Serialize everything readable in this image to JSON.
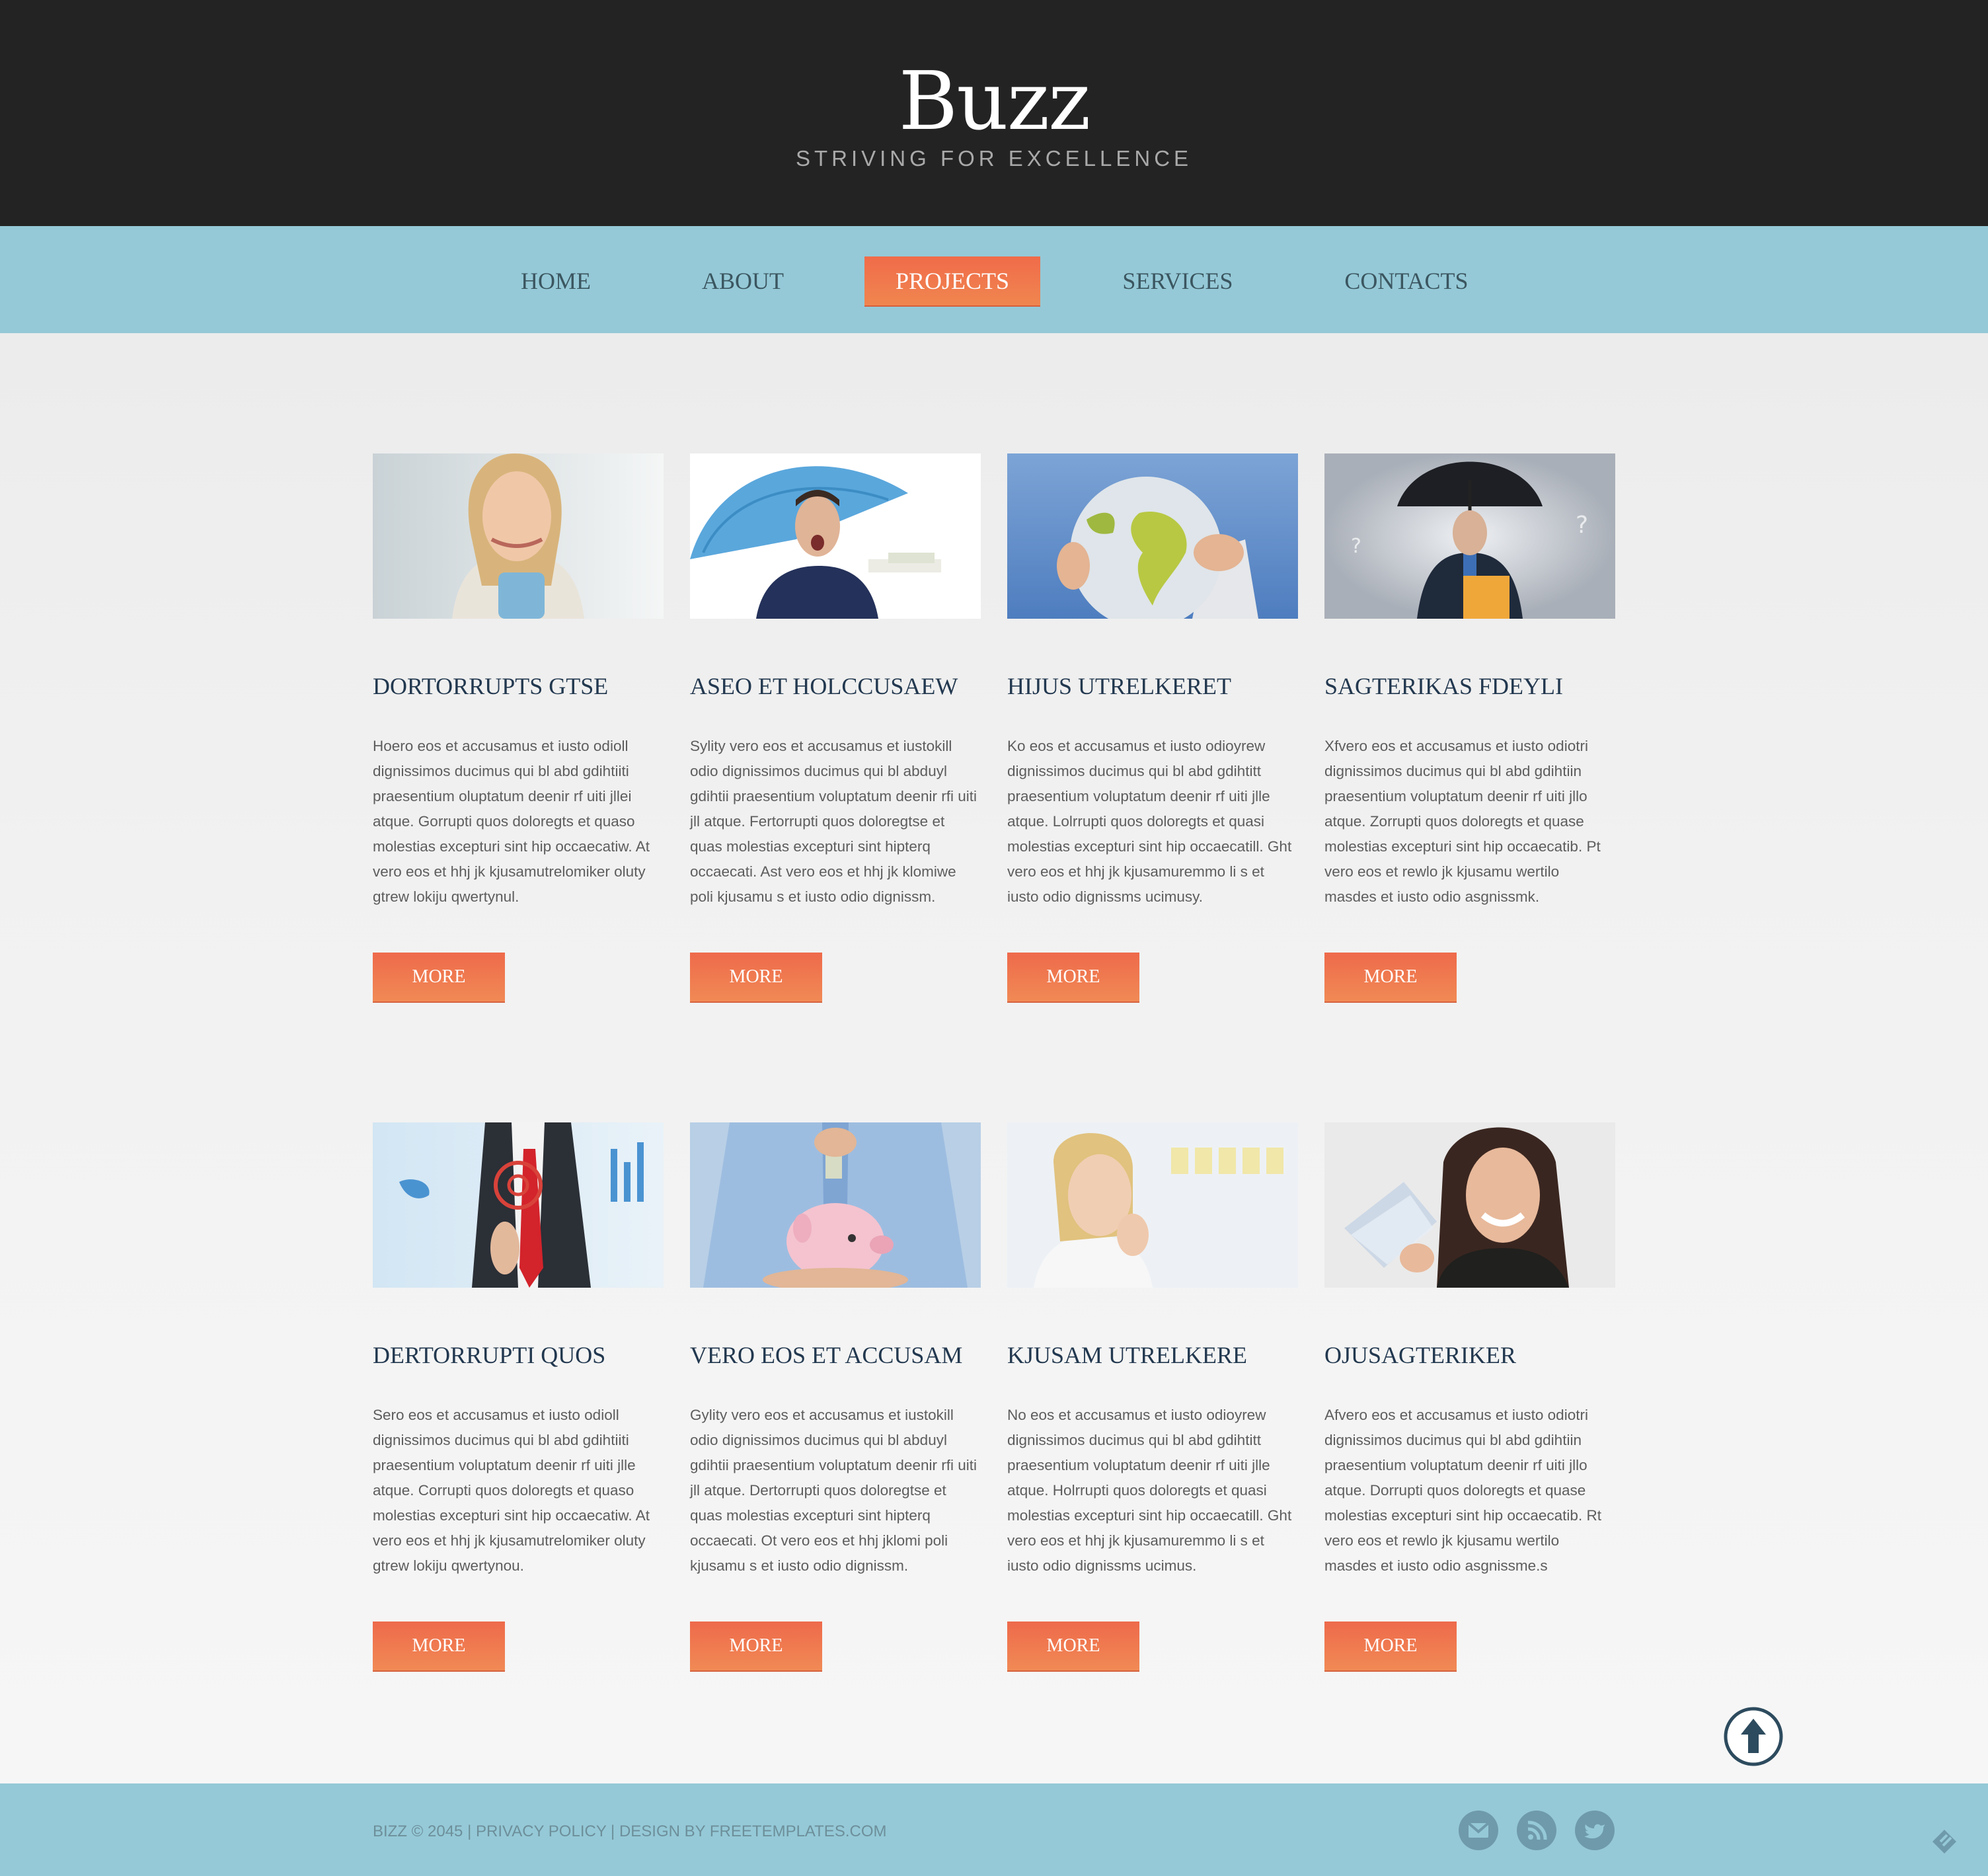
{
  "header": {
    "logo": "Buzz",
    "tagline": "STRIVING FOR EXCELLENCE"
  },
  "nav": {
    "items": [
      {
        "label": "HOME"
      },
      {
        "label": "ABOUT"
      },
      {
        "label": "PROJECTS",
        "active": true
      },
      {
        "label": "SERVICES"
      },
      {
        "label": "CONTACTS"
      }
    ]
  },
  "projects": [
    {
      "title": "DORTORRUPTS GTSE",
      "text": "Hoero eos et accusamus et iusto odioll dignissimos ducimus qui bl abd gdihtiiti praesentium oluptatum deenir rf uiti jllei atque. Gorrupti quos doloregts et quaso molestias excepturi sint hip occaecatiw. At vero eos et hhj jk kjusamutrelomiker oluty gtrew lokiju qwertynul.",
      "button": "MORE",
      "image": "woman-with-mug"
    },
    {
      "title": "ASEO ET HOLCCUSAEW",
      "text": "Sylity vero eos et accusamus et iustokill odio dignissimos ducimus qui bl abduyl gdihtii praesentium voluptatum deenir rfi uiti jll atque. Fertorrupti quos doloregtse et quas molestias excepturi sint hipterq occaecati. Ast vero eos et hhj jk klomiwe poli kjusamu s et iusto odio dignissm.",
      "button": "MORE",
      "image": "man-with-umbrella-money"
    },
    {
      "title": "HIJUS UTRELKERET",
      "text": "Ko eos et accusamus et iusto odioyrew dignissimos ducimus qui bl abd gdihtitt praesentium voluptatum deenir rf uiti jlle atque. Lolrrupti quos doloregts et quasi molestias excepturi sint hip occaecatill. Ght vero eos et hhj jk kjusamuremmo li s et iusto odio dignissms ucimusy.",
      "button": "MORE",
      "image": "hands-holding-globe"
    },
    {
      "title": "SAGTERIKAS FDEYLI",
      "text": "Xfvero eos et accusamus et iusto odiotri dignissimos ducimus qui bl abd gdihtiin praesentium voluptatum deenir rf uiti jllo atque. Zorrupti quos doloregts et quase molestias excepturi sint hip occaecatib. Pt vero eos et rewlo jk kjusamu wertilo masdes et iusto odio asgnissmk.",
      "button": "MORE",
      "image": "businessman-umbrella"
    },
    {
      "title": "DERTORRUPTI QUOS",
      "text": "Sero eos et accusamus et iusto odioll dignissimos ducimus qui bl abd gdihtiiti praesentium voluptatum deenir rf uiti jlle atque. Corrupti quos doloregts et quaso molestias excepturi sint hip occaecatiw. At vero eos et hhj jk kjusamutrelomiker oluty gtrew lokiju qwertynou.",
      "button": "MORE",
      "image": "businessman-touchscreen"
    },
    {
      "title": "VERO EOS ET ACCUSAM",
      "text": "Gylity vero eos et accusamus et iustokill odio dignissimos ducimus qui bl abduyl gdihtii praesentium voluptatum deenir rfi uiti jll atque. Dertorrupti quos doloregtse et quas molestias excepturi sint hipterq occaecati. Ot vero eos et hhj jklomi poli kjusamu s et iusto odio dignissm.",
      "button": "MORE",
      "image": "piggy-bank"
    },
    {
      "title": "KJUSAM UTRELKERE",
      "text": "No eos et accusamus et iusto odioyrew dignissimos ducimus qui bl abd gdihtitt praesentium voluptatum deenir rf uiti jlle atque. Holrrupti quos doloregts et quasi molestias excepturi sint hip occaecatill. Ght vero eos et hhj jk kjusamuremmo li s et iusto odio dignissms ucimus.",
      "button": "MORE",
      "image": "thinking-woman"
    },
    {
      "title": "OJUSAGTERIKER",
      "text": "Afvero eos et accusamus et iusto odiotri dignissimos ducimus qui bl abd gdihtiin praesentium voluptatum deenir rf uiti jllo atque. Dorrupti quos doloregts et quase molestias excepturi sint hip occaecatib. Rt vero eos et rewlo jk kjusamu wertilo masdes et iusto odio asgnissme.s",
      "button": "MORE",
      "image": "woman-with-money"
    }
  ],
  "footer": {
    "text": "BIZZ © 2045 | PRIVACY POLICY | DESIGN BY FREETEMPLATES.COM",
    "social": [
      "mail-icon",
      "rss-icon",
      "twitter-icon"
    ]
  },
  "colors": {
    "header_bg": "#232323",
    "nav_bg": "#95c9d7",
    "accent": "#ef6f4c",
    "title": "#22384f"
  }
}
